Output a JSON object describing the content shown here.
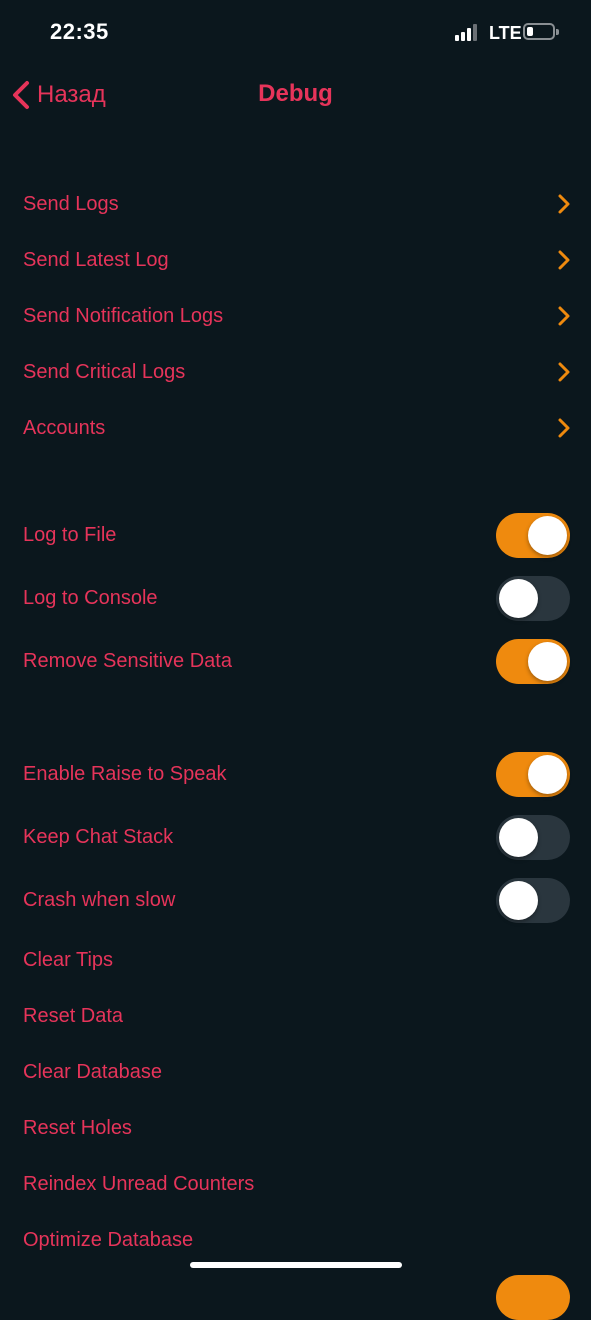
{
  "status_bar": {
    "time": "22:35",
    "network": "LTE",
    "battery_level": 0.25
  },
  "navbar": {
    "back_label": "Назад",
    "title": "Debug"
  },
  "section1": {
    "items": [
      {
        "label": "Send Logs"
      },
      {
        "label": "Send Latest Log"
      },
      {
        "label": "Send Notification Logs"
      },
      {
        "label": "Send Critical Logs"
      },
      {
        "label": "Accounts"
      }
    ]
  },
  "section2": {
    "items": [
      {
        "label": "Log to File",
        "on": true
      },
      {
        "label": "Log to Console",
        "on": false
      },
      {
        "label": "Remove Sensitive Data",
        "on": true
      }
    ]
  },
  "section3": {
    "toggles": [
      {
        "label": "Enable Raise to Speak",
        "on": true
      },
      {
        "label": "Keep Chat Stack",
        "on": false
      },
      {
        "label": "Crash when slow",
        "on": false
      }
    ],
    "actions": [
      {
        "label": "Clear Tips"
      },
      {
        "label": "Reset Data"
      },
      {
        "label": "Clear Database"
      },
      {
        "label": "Reset Holes"
      },
      {
        "label": "Reindex Unread Counters"
      },
      {
        "label": "Optimize Database"
      }
    ]
  },
  "colors": {
    "background": "#0b171d",
    "accent": "#e6345a",
    "toggle_on": "#ef8a0e",
    "toggle_off": "#2a363e"
  }
}
